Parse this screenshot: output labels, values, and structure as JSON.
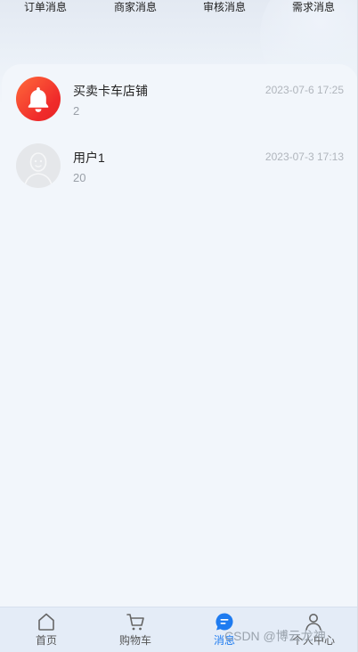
{
  "top_tabs": [
    {
      "label": "订单消息"
    },
    {
      "label": "商家消息"
    },
    {
      "label": "审核消息"
    },
    {
      "label": "需求消息"
    }
  ],
  "messages": [
    {
      "name": "买卖卡车店铺",
      "count": "2",
      "time": "2023-07-6 17:25",
      "avatar_icon": "bell-icon"
    },
    {
      "name": "用户1",
      "count": "20",
      "time": "2023-07-3 17:13",
      "avatar_icon": "default-user-avatar-icon"
    }
  ],
  "bottom_nav": [
    {
      "label": "首页",
      "icon": "home-icon",
      "active": false
    },
    {
      "label": "购物车",
      "icon": "cart-icon",
      "active": false
    },
    {
      "label": "消息",
      "icon": "chat-bubble-icon",
      "active": true
    },
    {
      "label": "个人中心",
      "icon": "user-icon",
      "active": false
    }
  ],
  "watermark": "CSDN @博云龙神",
  "colors": {
    "accent": "#1e7bf0",
    "bell_avatar_gradient_start": "#ff6a3a",
    "bell_avatar_gradient_end": "#e62424",
    "nav_background": "#e4ecf7",
    "panel_background": "#f2f6fb"
  }
}
